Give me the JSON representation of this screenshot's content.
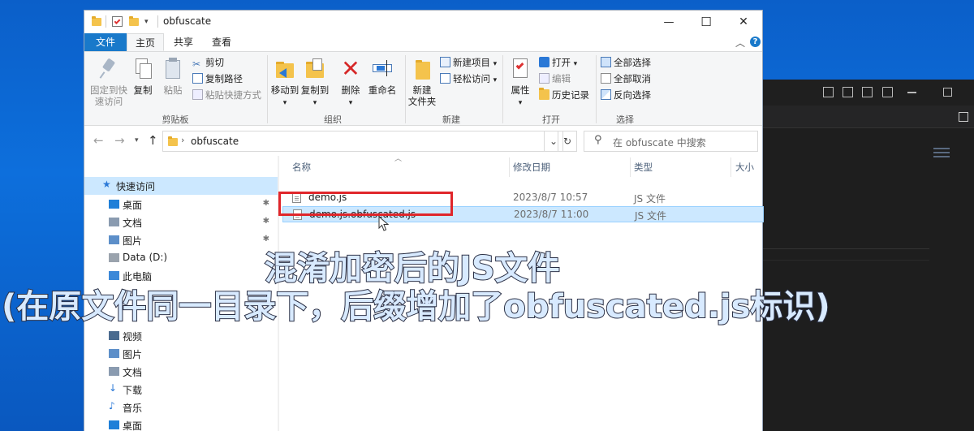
{
  "window": {
    "title": "obfuscate",
    "minimize": "—",
    "maximize": "☐",
    "close": "✕"
  },
  "ribbon_tabs": [
    "文件",
    "主页",
    "共享",
    "查看"
  ],
  "ribbon": {
    "clipboard": {
      "label": "剪贴板",
      "pin_quick": "固定到快\n速访问",
      "copy": "复制",
      "paste": "粘贴",
      "cut": "剪切",
      "copy_path": "复制路径",
      "paste_shortcut": "粘贴快捷方式"
    },
    "organize": {
      "label": "组织",
      "move_to": "移动到",
      "copy_to": "复制到",
      "delete": "删除",
      "rename": "重命名"
    },
    "new": {
      "label": "新建",
      "new_folder": "新建\n文件夹",
      "new_item": "新建项目",
      "easy_access": "轻松访问"
    },
    "open": {
      "label": "打开",
      "properties": "属性",
      "open": "打开",
      "edit": "编辑",
      "history": "历史记录"
    },
    "select": {
      "label": "选择",
      "select_all": "全部选择",
      "select_none": "全部取消",
      "invert": "反向选择"
    }
  },
  "address": {
    "path": "obfuscate",
    "search_placeholder": "在 obfuscate 中搜索"
  },
  "nav_pane": [
    {
      "label": "快速访问",
      "icon": "star-icon",
      "pinned": false,
      "selected": true
    },
    {
      "label": "桌面",
      "icon": "desktop-icon",
      "pinned": true
    },
    {
      "label": "文档",
      "icon": "documents-icon",
      "pinned": true
    },
    {
      "label": "图片",
      "icon": "pictures-icon",
      "pinned": true
    },
    {
      "label": "Data (D:)",
      "icon": "drive-icon",
      "pinned": false
    },
    {
      "label": "此电脑",
      "icon": "computer-icon",
      "pinned": false
    },
    {
      "label": "视频",
      "icon": "videos-icon",
      "pinned": false
    },
    {
      "label": "图片",
      "icon": "pictures-icon",
      "pinned": false
    },
    {
      "label": "文档",
      "icon": "documents-icon",
      "pinned": false
    },
    {
      "label": "下载",
      "icon": "download-icon",
      "pinned": false
    },
    {
      "label": "音乐",
      "icon": "music-icon",
      "pinned": false
    },
    {
      "label": "桌面",
      "icon": "desktop-icon",
      "pinned": false
    }
  ],
  "columns": {
    "name": "名称",
    "date": "修改日期",
    "type": "类型",
    "size": "大小"
  },
  "files": [
    {
      "name": "demo.js",
      "date": "2023/8/7 10:57",
      "type": "JS 文件",
      "selected": false
    },
    {
      "name": "demo.js.obfuscated.js",
      "date": "2023/8/7 11:00",
      "type": "JS 文件",
      "selected": true
    }
  ],
  "captions": {
    "line1": "混淆加密后的JS文件",
    "line2": "(在原文件同一目录下，后缀增加了obfuscated.js标识)"
  },
  "colors": {
    "accent": "#1979ca",
    "selection": "#cce8ff",
    "highlight": "#e0262b"
  }
}
